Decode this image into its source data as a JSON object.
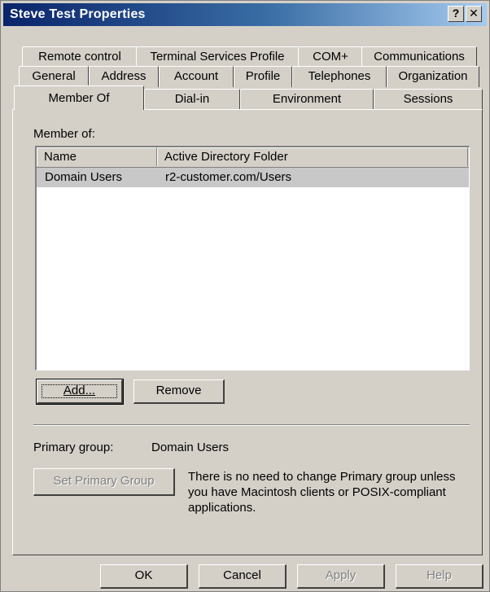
{
  "window": {
    "title": "Steve Test Properties",
    "help_button": "?",
    "close_button": "X"
  },
  "tabs": {
    "row1": [
      "Remote control",
      "Terminal Services Profile",
      "COM+",
      "Communications"
    ],
    "row2": [
      "General",
      "Address",
      "Account",
      "Profile",
      "Telephones",
      "Organization"
    ],
    "row3": [
      "Member Of",
      "Dial-in",
      "Environment",
      "Sessions"
    ],
    "active": "Member Of"
  },
  "member_of": {
    "label": "Member of:",
    "columns": [
      "Name",
      "Active Directory Folder"
    ],
    "rows": [
      {
        "name": "Domain Users",
        "folder": "r2-customer.com/Users"
      }
    ]
  },
  "buttons": {
    "add": "Add...",
    "remove": "Remove",
    "set_primary": "Set Primary Group",
    "ok": "OK",
    "cancel": "Cancel",
    "apply": "Apply",
    "help": "Help"
  },
  "primary_group": {
    "label": "Primary group:",
    "value": "Domain Users",
    "note_line1": "There is no need to change Primary group unless",
    "note_line2": "you have Macintosh clients or POSIX-compliant",
    "note_line3": "applications."
  },
  "colors": {
    "dialog_bg": "#d4d0c8",
    "titlebar_start": "#0a246a",
    "titlebar_end": "#a6caf0",
    "selection": "#c8c8c8"
  }
}
